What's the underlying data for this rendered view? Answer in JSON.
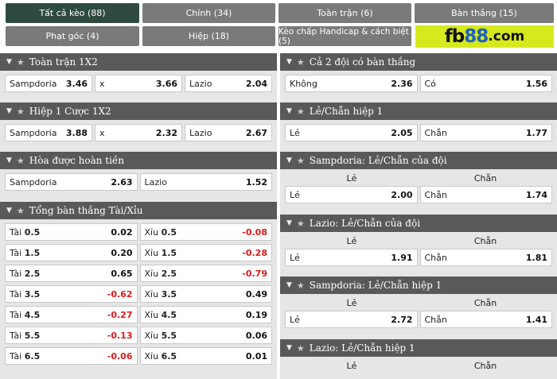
{
  "tabs": [
    {
      "label": "Tất cả kèo (88)",
      "active": true
    },
    {
      "label": "Chính (34)"
    },
    {
      "label": "Toàn trận (6)"
    },
    {
      "label": "Bàn thắng (15)"
    },
    {
      "label": "Phạt góc (4)"
    },
    {
      "label": "Hiệp (18)"
    },
    {
      "label": "Kèo chấp Handicap & cách biệt (5)"
    }
  ],
  "brand": {
    "part1": "fb",
    "part2": "88",
    "part3": ".com"
  },
  "left": {
    "full_1x2": {
      "title": "Toàn trận 1X2",
      "cells": [
        {
          "label": "Sampdoria",
          "odd": "3.46"
        },
        {
          "label": "x",
          "odd": "3.66"
        },
        {
          "label": "Lazio",
          "odd": "2.04"
        }
      ]
    },
    "half_1x2": {
      "title": "Hiệp 1 Cược 1X2",
      "cells": [
        {
          "label": "Sampdoria",
          "odd": "3.88"
        },
        {
          "label": "x",
          "odd": "2.32"
        },
        {
          "label": "Lazio",
          "odd": "2.67"
        }
      ]
    },
    "draw_refund": {
      "title": "Hòa được hoàn tiền",
      "cells": [
        {
          "label": "Sampdoria",
          "odd": "2.63"
        },
        {
          "label": "Lazio",
          "odd": "1.52"
        }
      ]
    },
    "over_under": {
      "title": "Tổng bàn thắng Tài/Xỉu",
      "rows": [
        {
          "over_label": "Tài",
          "line": "0.5",
          "over_odd": "0.02",
          "under_label": "Xỉu",
          "under_line": "0.5",
          "under_odd": "-0.08"
        },
        {
          "over_label": "Tài",
          "line": "1.5",
          "over_odd": "0.20",
          "under_label": "Xỉu",
          "under_line": "1.5",
          "under_odd": "-0.28"
        },
        {
          "over_label": "Tài",
          "line": "2.5",
          "over_odd": "0.65",
          "under_label": "Xỉu",
          "under_line": "2.5",
          "under_odd": "-0.79"
        },
        {
          "over_label": "Tài",
          "line": "3.5",
          "over_odd": "-0.62",
          "under_label": "Xỉu",
          "under_line": "3.5",
          "under_odd": "0.49"
        },
        {
          "over_label": "Tài",
          "line": "4.5",
          "over_odd": "-0.27",
          "under_label": "Xỉu",
          "under_line": "4.5",
          "under_odd": "0.19"
        },
        {
          "over_label": "Tài",
          "line": "5.5",
          "over_odd": "-0.13",
          "under_label": "Xỉu",
          "under_line": "5.5",
          "under_odd": "0.06"
        },
        {
          "over_label": "Tài",
          "line": "6.5",
          "over_odd": "-0.06",
          "under_label": "Xỉu",
          "under_line": "6.5",
          "under_odd": "0.01"
        }
      ]
    }
  },
  "right": {
    "both_score": {
      "title": "Cả 2 đội có bàn thắng",
      "cells": [
        {
          "label": "Không",
          "odd": "2.36"
        },
        {
          "label": "Có",
          "odd": "1.56"
        }
      ]
    },
    "oe_half": {
      "title": "Lẻ/Chẵn hiệp 1",
      "cells": [
        {
          "label": "Lẻ",
          "odd": "2.05"
        },
        {
          "label": "Chẵn",
          "odd": "1.77"
        }
      ]
    },
    "samp_oe": {
      "title": "Sampdoria: Lẻ/Chẵn của đội",
      "head_odd": "Lẻ",
      "head_even": "Chẵn",
      "cells": [
        {
          "label": "Lẻ",
          "odd": "2.00"
        },
        {
          "label": "Chẵn",
          "odd": "1.74"
        }
      ]
    },
    "lazio_oe": {
      "title": "Lazio: Lẻ/Chẵn của đội",
      "head_odd": "Lẻ",
      "head_even": "Chẵn",
      "cells": [
        {
          "label": "Lẻ",
          "odd": "1.91"
        },
        {
          "label": "Chẵn",
          "odd": "1.81"
        }
      ]
    },
    "samp_oe_half": {
      "title": "Sampdoria: Lẻ/Chẵn hiệp 1",
      "head_odd": "Lẻ",
      "head_even": "Chẵn",
      "cells": [
        {
          "label": "Lẻ",
          "odd": "2.72"
        },
        {
          "label": "Chẵn",
          "odd": "1.41"
        }
      ]
    },
    "lazio_oe_half": {
      "title": "Lazio: Lẻ/Chẵn hiệp 1",
      "head_odd": "Lẻ",
      "head_even": "Chẵn"
    }
  },
  "colors": {
    "tab_active": "#2e4a3f",
    "tab": "#7a7a7a",
    "header": "#595959",
    "negative": "#e01a1a",
    "brand_bg": "#d6e91d",
    "brand_blue": "#1c5fc4"
  },
  "icons": {
    "collapse": "caret-down-icon",
    "favorite": "star-icon"
  }
}
